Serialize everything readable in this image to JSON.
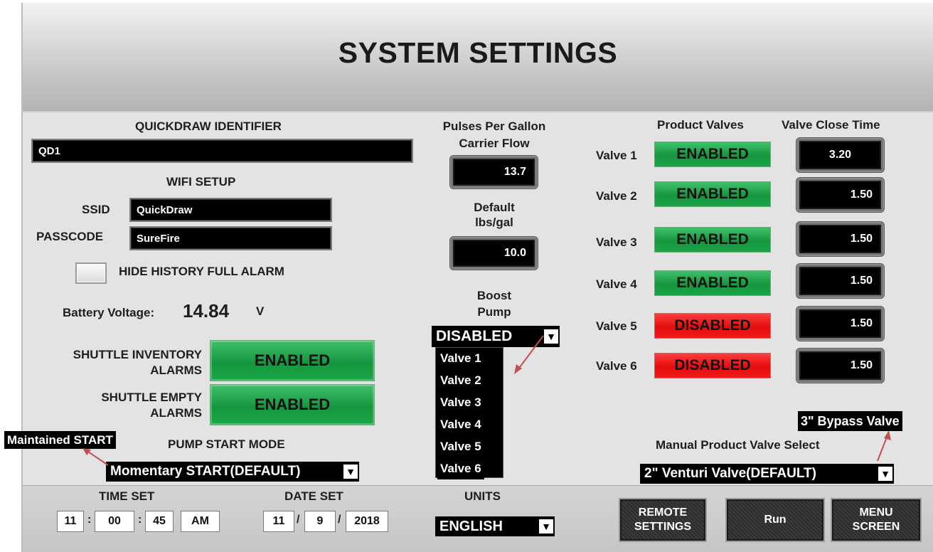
{
  "title": "SYSTEM SETTINGS",
  "identifier": {
    "label": "QUICKDRAW IDENTIFIER",
    "value": "QD1"
  },
  "wifi": {
    "label": "WIFI SETUP",
    "ssid_label": "SSID",
    "ssid_value": "QuickDraw",
    "passcode_label": "PASSCODE",
    "passcode_value": "SureFire"
  },
  "hide_history": {
    "label": "HIDE HISTORY FULL ALARM",
    "checked": false
  },
  "battery": {
    "label": "Battery Voltage:",
    "value": "14.84",
    "unit": "V"
  },
  "shuttle_inventory": {
    "label1": "SHUTTLE INVENTORY",
    "label2": "ALARMS",
    "state": "ENABLED"
  },
  "shuttle_empty": {
    "label1": "SHUTTLE EMPTY",
    "label2": "ALARMS",
    "state": "ENABLED"
  },
  "pump_start": {
    "label": "PUMP START MODE",
    "popup_option": "Maintained START",
    "selected": "Momentary START(DEFAULT)"
  },
  "pulses": {
    "label1": "Pulses Per Gallon",
    "label2": "Carrier Flow",
    "value": "13.7"
  },
  "default_density": {
    "label1": "Default",
    "label2": "lbs/gal",
    "value": "10.0"
  },
  "boost_pump": {
    "label1": "Boost",
    "label2": "Pump",
    "selected": "DISABLED",
    "options": [
      "Valve 1",
      "Valve 2",
      "Valve 3",
      "Valve 4",
      "Valve 5",
      "Valve 6"
    ]
  },
  "valves": {
    "header_product": "Product Valves",
    "header_close": "Valve Close Time",
    "rows": [
      {
        "label": "Valve 1",
        "state": "ENABLED",
        "close_time": "3.20"
      },
      {
        "label": "Valve 2",
        "state": "ENABLED",
        "close_time": "1.50"
      },
      {
        "label": "Valve 3",
        "state": "ENABLED",
        "close_time": "1.50"
      },
      {
        "label": "Valve 4",
        "state": "ENABLED",
        "close_time": "1.50"
      },
      {
        "label": "Valve 5",
        "state": "DISABLED",
        "close_time": "1.50"
      },
      {
        "label": "Valve 6",
        "state": "DISABLED",
        "close_time": "1.50"
      }
    ]
  },
  "manual_valve": {
    "label": "Manual Product Valve Select",
    "popup_option": "3\" Bypass Valve",
    "selected": "2\" Venturi Valve(DEFAULT)"
  },
  "time_set": {
    "label": "TIME SET",
    "hour": "11",
    "minute": "00",
    "second": "45",
    "ampm": "AM",
    "sep": ":"
  },
  "date_set": {
    "label": "DATE SET",
    "month": "11",
    "day": "9",
    "year": "2018",
    "sep": "/"
  },
  "units": {
    "label": "UNITS",
    "selected": "ENGLISH"
  },
  "buttons": {
    "remote_line1": "REMOTE",
    "remote_line2": "SETTINGS",
    "run": "Run",
    "menu_line1": "MENU",
    "menu_line2": "SCREEN"
  },
  "icons": {
    "dropdown": "chevron-down-icon",
    "annotation": "red-arrow-icon"
  },
  "colors": {
    "enabled": "#1aa548",
    "disabled": "#f21a1a",
    "annotation_arrow": "#c0504d"
  }
}
